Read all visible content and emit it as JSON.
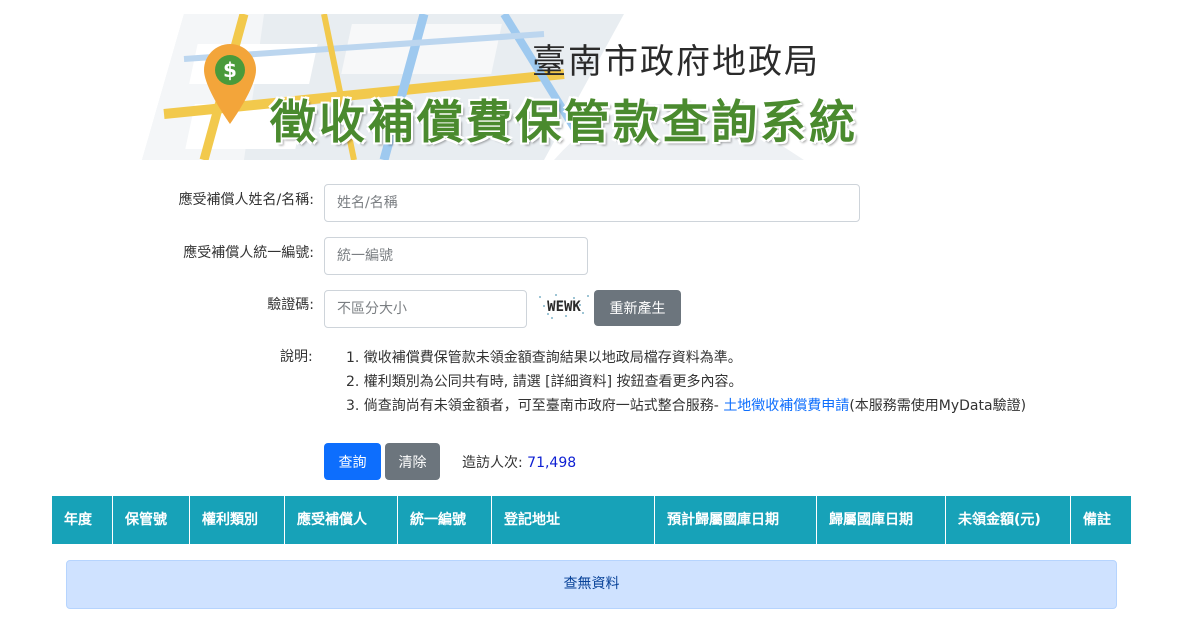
{
  "banner": {
    "org_name": "臺南市政府地政局",
    "system_name": "徵收補償費保管款查詢系統",
    "pin_symbol": "$"
  },
  "form": {
    "name_label": "應受補償人姓名/名稱:",
    "name_placeholder": "姓名/名稱",
    "id_label": "應受補償人統一編號:",
    "id_placeholder": "統一編號",
    "captcha_label": "驗證碼:",
    "captcha_placeholder": "不區分大小",
    "captcha_text": "WEWK",
    "regenerate_label": "重新產生"
  },
  "notes": {
    "label": "說明:",
    "line1": "1. 徵收補償費保管款未領金額查詢結果以地政局檔存資料為準。",
    "line2": "2. 權利類別為公同共有時, 請選 [詳細資料] 按鈕查看更多內容。",
    "line3_prefix": "3. 倘查詢尚有未領金額者，可至臺南市政府一站式整合服務- ",
    "line3_link": "土地徵收補償費申請",
    "line3_suffix": "(本服務需使用MyData驗證)"
  },
  "actions": {
    "query_label": "查詢",
    "clear_label": "清除",
    "visits_label": "造訪人次: ",
    "visits_count": "71,498"
  },
  "table": {
    "columns": [
      "年度",
      "保管號",
      "權利類別",
      "應受補償人",
      "統一編號",
      "登記地址",
      "預計歸屬國庫日期",
      "歸屬國庫日期",
      "未領金額(元)",
      "備註"
    ],
    "empty_message": "查無資料"
  },
  "colors": {
    "header_teal": "#17a2b8",
    "primary_blue": "#0d6efd",
    "secondary_gray": "#6c757d",
    "title_green": "#4a8a2e",
    "nodata_bg": "#cfe2ff"
  }
}
